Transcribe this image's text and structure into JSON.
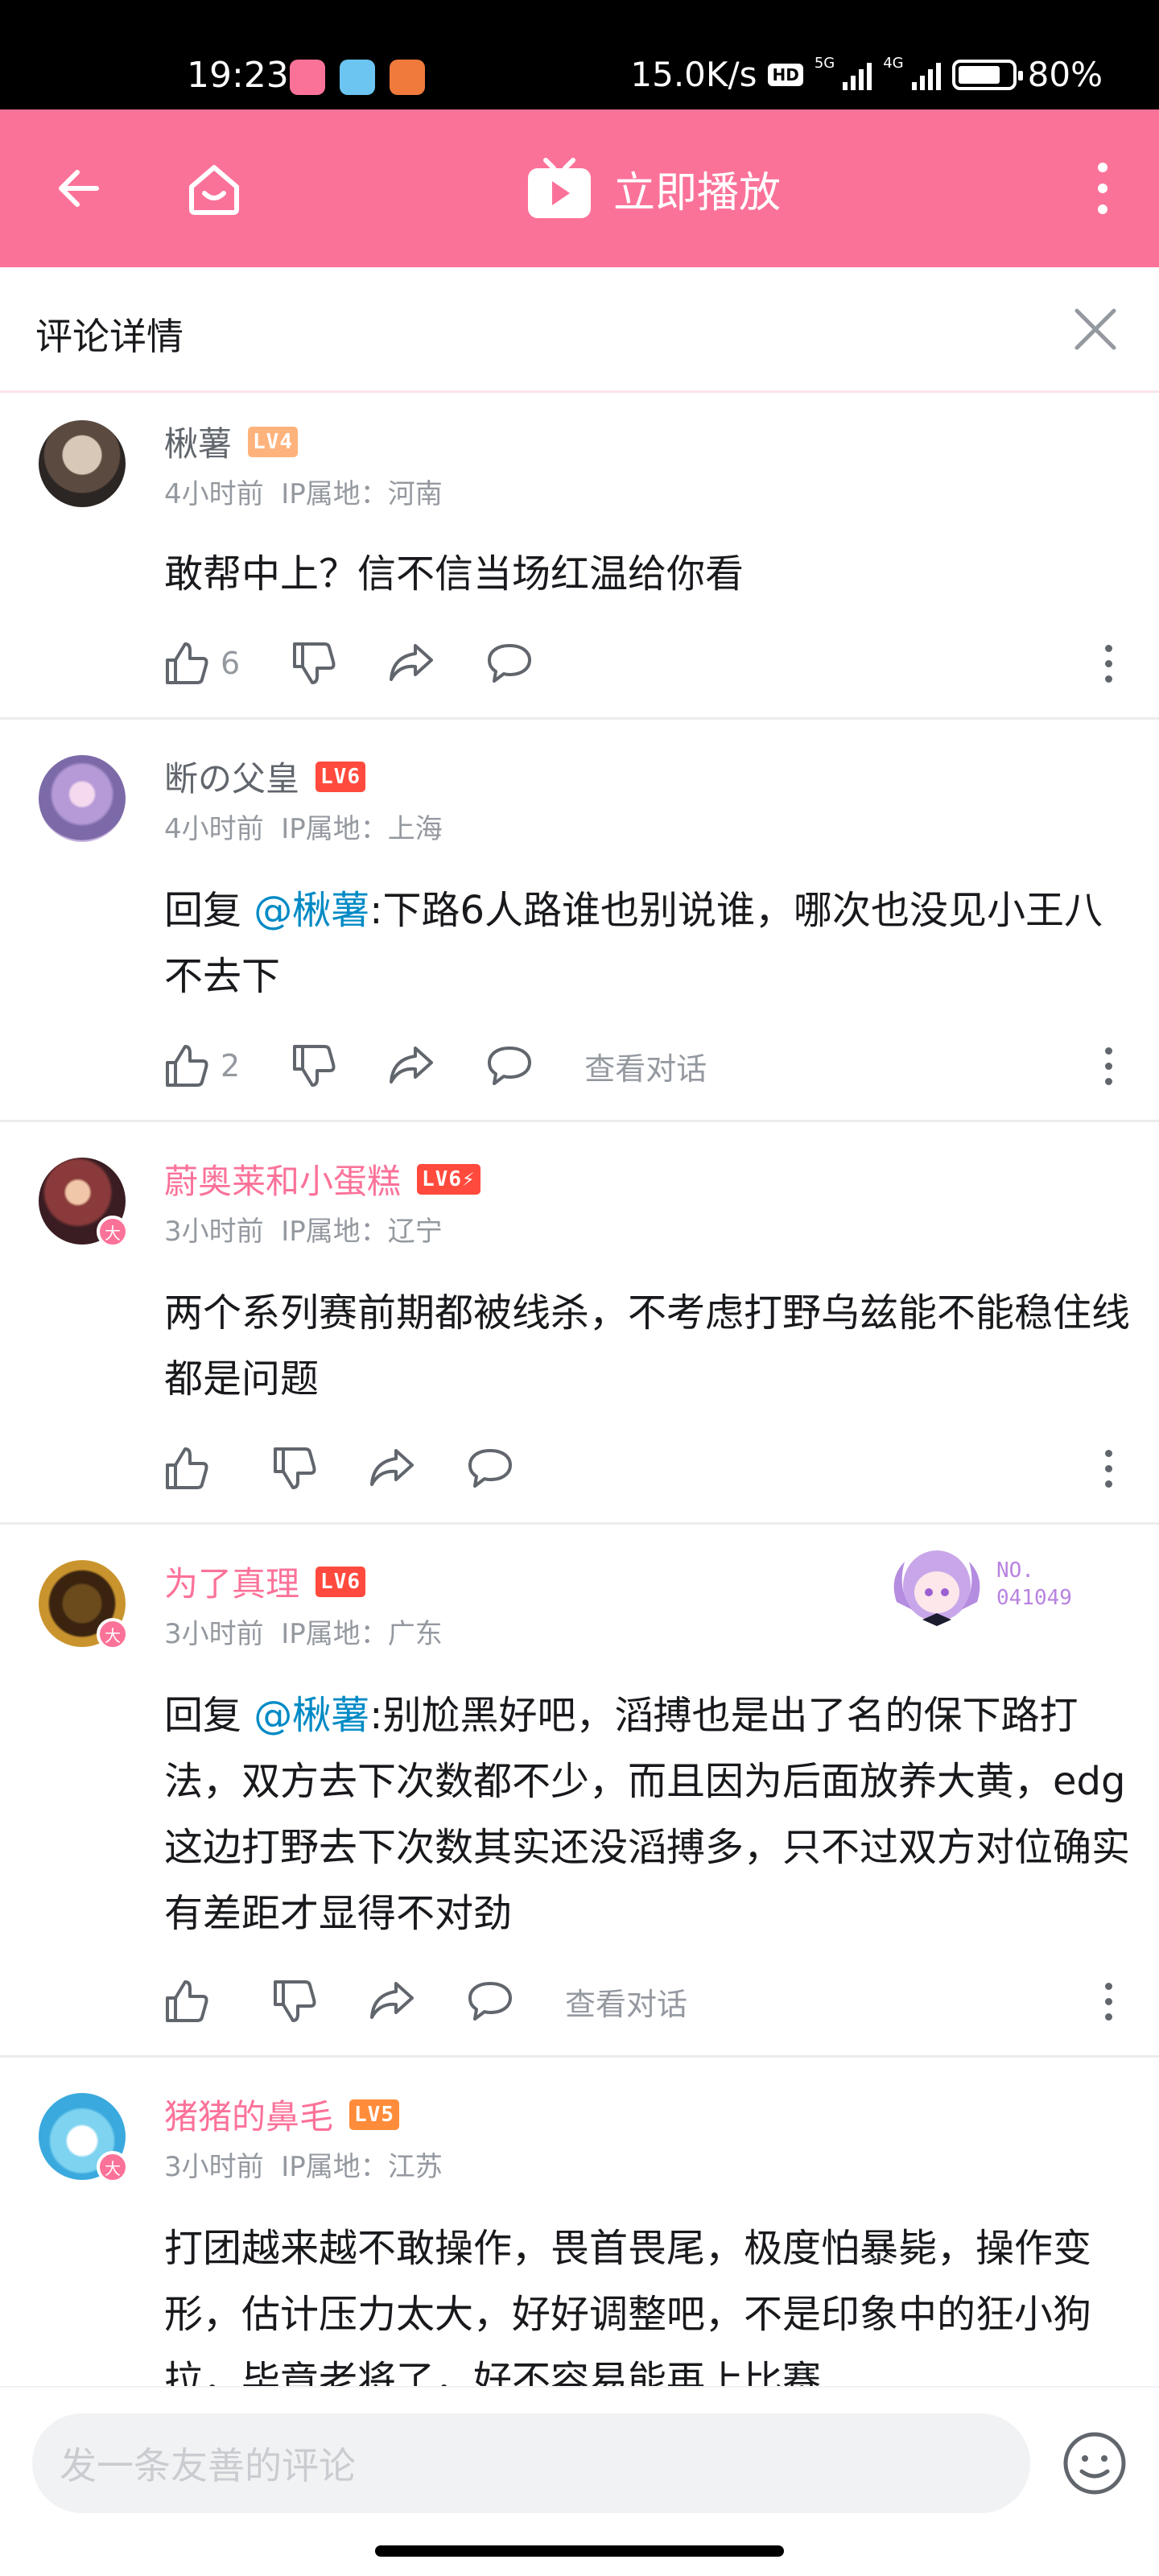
{
  "status_bar": {
    "time": "19:23",
    "net_speed": "15.0K/s",
    "hd": "HD",
    "net_5g": "5G",
    "net_4g": "4G",
    "battery": "80%",
    "battery_level": 0.8
  },
  "navbar": {
    "play_label": "立即播放",
    "bg_color": "#fb7299"
  },
  "section": {
    "title": "评论详情"
  },
  "comments": [
    {
      "username": "楸薯",
      "level": "LV4",
      "level_color": "#ffb37c",
      "vip": false,
      "time": "4小时前",
      "ip": "IP属地：河南",
      "reply_prefix": "",
      "mention": "",
      "text": "敢帮中上？信不信当场红温给你看",
      "likes": "6",
      "view_conversation": ""
    },
    {
      "username": "断の父皇",
      "level": "LV6",
      "level_color": "#ff4a3d",
      "vip": false,
      "time": "4小时前",
      "ip": "IP属地：上海",
      "reply_prefix": "回复 ",
      "mention": "@楸薯",
      "text": ":下路6人路谁也别说谁，哪次也没见小王八不去下",
      "likes": "2",
      "view_conversation": "查看对话"
    },
    {
      "username": "蔚奥莱和小蛋糕",
      "level": "LV6⚡",
      "level_color": "#ff4a3d",
      "vip": true,
      "vip_badge": "大",
      "time": "3小时前",
      "ip": "IP属地：辽宁",
      "reply_prefix": "",
      "mention": "",
      "text": "两个系列赛前期都被线杀，不考虑打野乌兹能不能稳住线都是问题",
      "likes": "",
      "view_conversation": ""
    },
    {
      "username": "为了真理",
      "level": "LV6",
      "level_color": "#ff4a3d",
      "vip": true,
      "vip_badge": "大",
      "time": "3小时前",
      "ip": "IP属地：广东",
      "reply_prefix": "回复 ",
      "mention": "@楸薯",
      "text": ":别尬黑好吧，滔搏也是出了名的保下路打法，双方去下次数都不少，而且因为后面放养大黄，edg这边打野去下次数其实还没滔搏多，只不过双方对位确实有差距才显得不对劲",
      "likes": "",
      "view_conversation": "查看对话",
      "fan_badge_no": "NO.",
      "fan_badge_id": "041049"
    },
    {
      "username": "猪猪的鼻毛",
      "level": "LV5",
      "level_color": "#ff8c3a",
      "vip": true,
      "vip_badge": "大",
      "time": "3小时前",
      "ip": "IP属地：江苏",
      "reply_prefix": "",
      "mention": "",
      "text": "打团越来越不敢操作，畏首畏尾，极度怕暴毙，操作变形，估计压力太大，好好调整吧，不是印象中的狂小狗拉，毕竟老将了，好不容易能再上比赛",
      "likes": "",
      "view_conversation": ""
    }
  ],
  "bottom": {
    "input_placeholder": "发一条友善的评论"
  }
}
